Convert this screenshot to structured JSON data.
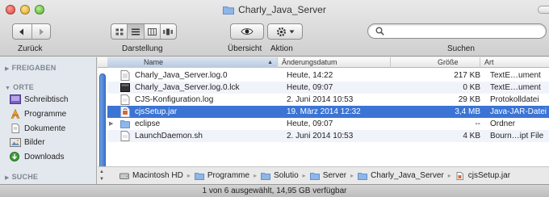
{
  "window": {
    "title": "Charly_Java_Server"
  },
  "toolbar": {
    "back_label": "Zurück",
    "view_label": "Darstellung",
    "quicklook_label": "Übersicht",
    "action_label": "Aktion",
    "search_label": "Suchen",
    "search_value": ""
  },
  "sidebar": {
    "sections": [
      {
        "label": "FREIGABEN"
      },
      {
        "label": "ORTE"
      },
      {
        "label": "SUCHE"
      }
    ],
    "items": [
      {
        "label": "Schreibtisch",
        "icon": "desktop-icon"
      },
      {
        "label": "Programme",
        "icon": "applications-icon"
      },
      {
        "label": "Dokumente",
        "icon": "documents-icon"
      },
      {
        "label": "Bilder",
        "icon": "pictures-icon"
      },
      {
        "label": "Downloads",
        "icon": "downloads-icon"
      }
    ]
  },
  "columns": {
    "name": "Name",
    "date": "Änderungsdatum",
    "size": "Größe",
    "kind": "Art"
  },
  "files": [
    {
      "name": "Charly_Java_Server.log.0",
      "date": "Heute, 14:22",
      "size": "217 KB",
      "kind": "TextE…ument",
      "icon": "text-file-icon"
    },
    {
      "name": "Charly_Java_Server.log.0.lck",
      "date": "Heute, 09:07",
      "size": "0 KB",
      "kind": "TextE…ument",
      "icon": "exec-file-icon"
    },
    {
      "name": "CJS-Konfiguration.log",
      "date": "2. Juni 2014 10:53",
      "size": "29 KB",
      "kind": "Protokolldatei",
      "icon": "log-file-icon"
    },
    {
      "name": "cjsSetup.jar",
      "date": "19. März 2014 12:32",
      "size": "3,4 MB",
      "kind": "Java-JAR-Datei",
      "icon": "jar-file-icon",
      "selected": true
    },
    {
      "name": "eclipse",
      "date": "Heute, 09:07",
      "size": "--",
      "kind": "Ordner",
      "icon": "folder-icon"
    },
    {
      "name": "LaunchDaemon.sh",
      "date": "2. Juni 2014 10:53",
      "size": "4 KB",
      "kind": "Bourn…ipt File",
      "icon": "shell-file-icon"
    }
  ],
  "path": [
    "Macintosh HD",
    "Programme",
    "Solutio",
    "Server",
    "Charly_Java_Server",
    "cjsSetup.jar"
  ],
  "status": "1 von 6 ausgewählt, 14,95 GB verfügbar",
  "colors": {
    "selection": "#3b74d4",
    "sidebar_bg": "#e3e8ee",
    "alt_row": "#f0f4fa"
  }
}
